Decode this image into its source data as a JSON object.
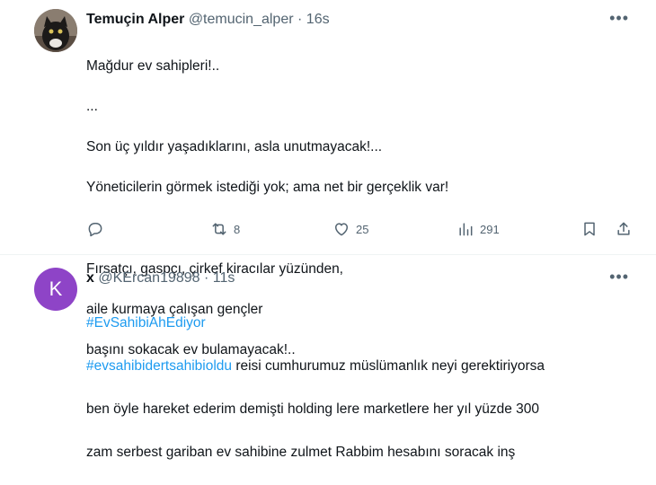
{
  "tweet1": {
    "display_name": "Temuçin Alper",
    "handle": "@temucin_alper",
    "separator": "·",
    "time": "16s",
    "more_label": "•••",
    "lines": [
      "Mağdur ev sahipleri!..",
      "...",
      "Son üç yıldır yaşadıklarını, asla unutmayacak!...",
      "Yöneticilerin görmek istediği yok; ama net bir gerçeklik var!",
      "",
      "Fırsatçı, gaspçı, çirkef kiracılar yüzünden,",
      "aile kurmaya çalışan gençler",
      "başını sokacak ev bulamayacak!.."
    ],
    "actions": {
      "reply_count": "",
      "retweet_count": "8",
      "like_count": "25",
      "views_count": "291"
    }
  },
  "tweet2": {
    "avatar_letter": "K",
    "display_name": "x",
    "handle": "@KErcan19898",
    "separator": "·",
    "time": "11s",
    "more_label": "•••",
    "hashtag1": "#EvSahibiAhEdiyor",
    "hashtag2": "#evsahibidertsahibioldu",
    "text_after_hashtag2": " reisi cumhurumuz müslümanlık neyi gerektiriyorsa",
    "line3": "ben öyle hareket ederim demişti holding lere marketlere her yıl yüzde 300",
    "line4": "zam serbest gariban ev sahibine zulmet Rabbim hesabını soracak inş"
  },
  "colors": {
    "link": "#1d9bf0",
    "secondary": "#536471",
    "avatar2": "#8e44c7"
  }
}
